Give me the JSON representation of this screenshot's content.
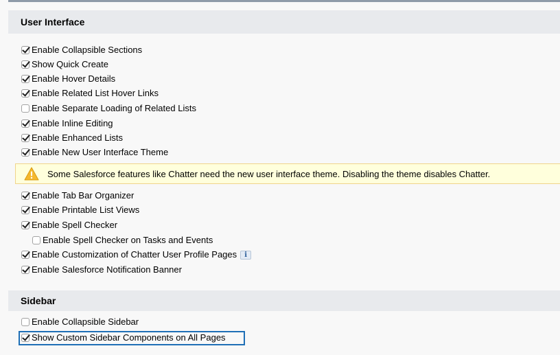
{
  "sections": {
    "user_interface": {
      "title": "User Interface",
      "options": [
        {
          "label": "Enable Collapsible Sections",
          "checked": true
        },
        {
          "label": "Show Quick Create",
          "checked": true
        },
        {
          "label": "Enable Hover Details",
          "checked": true
        },
        {
          "label": "Enable Related List Hover Links",
          "checked": true
        },
        {
          "label": "Enable Separate Loading of Related Lists",
          "checked": false
        },
        {
          "label": "Enable Inline Editing",
          "checked": true
        },
        {
          "label": "Enable Enhanced Lists",
          "checked": true
        },
        {
          "label": "Enable New User Interface Theme",
          "checked": true
        },
        {
          "label": "Enable Tab Bar Organizer",
          "checked": true
        },
        {
          "label": "Enable Printable List Views",
          "checked": true
        },
        {
          "label": "Enable Spell Checker",
          "checked": true
        },
        {
          "label": "Enable Spell Checker on Tasks and Events",
          "checked": false
        },
        {
          "label": "Enable Customization of Chatter User Profile Pages",
          "checked": true
        },
        {
          "label": "Enable Salesforce Notification Banner",
          "checked": true
        }
      ],
      "warning": "Some Salesforce features like Chatter need the new user interface theme. Disabling the theme disables Chatter.",
      "info_icon_glyph": "i"
    },
    "sidebar": {
      "title": "Sidebar",
      "options": [
        {
          "label": "Enable Collapsible Sidebar",
          "checked": false
        },
        {
          "label": "Show Custom Sidebar Components on All Pages",
          "checked": true
        }
      ]
    }
  },
  "colors": {
    "warning_background": "#ffffdc",
    "warning_icon": "#f5b82e",
    "highlight_border": "#1e6fb6"
  },
  "icons": {
    "warning": "warning-triangle-icon",
    "info": "info-icon"
  }
}
